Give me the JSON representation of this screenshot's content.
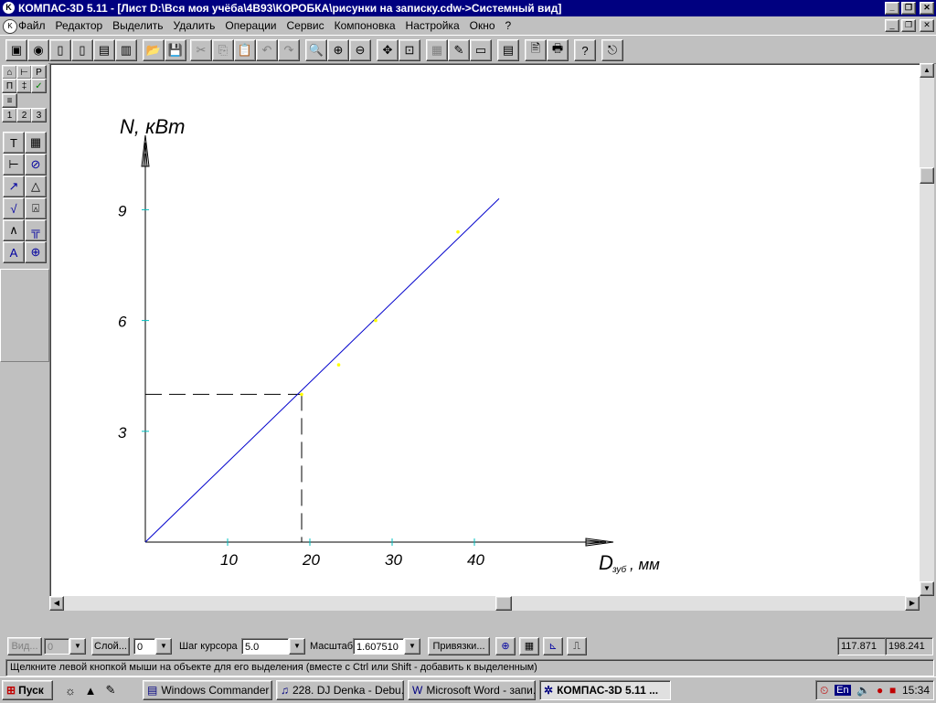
{
  "window": {
    "title": "КОМПАС-3D 5.11 - [Лист D:\\Вся моя учёба\\4В93\\КОРОБКА\\рисунки на записку.cdw->Системный вид]",
    "app_icon_glyph": "K",
    "minimize_glyph": "_",
    "maximize_glyph": "❐",
    "close_glyph": "✕"
  },
  "menu": {
    "items": [
      "Файл",
      "Редактор",
      "Выделить",
      "Удалить",
      "Операции",
      "Сервис",
      "Компоновка",
      "Настройка",
      "Окно",
      "?"
    ]
  },
  "toolbar": {
    "icons": [
      "save-all-icon",
      "preview-icon",
      "new-sheet-icon",
      "new-fragment-icon",
      "new-document-icon",
      "new-spec-icon",
      "open-icon",
      "save-icon",
      "cut-icon",
      "copy-icon",
      "paste-icon",
      "undo-icon",
      "redo-icon",
      "zoom-icon",
      "zoom-in-icon",
      "zoom-out-icon",
      "pan-icon",
      "zoom-fit-icon",
      "layers-icon",
      "properties-icon",
      "view-icon",
      "calculator-icon",
      "print-preview-icon",
      "print-icon",
      "help-icon",
      "exit-icon"
    ],
    "glyphs": [
      "▣",
      "◉",
      "▯",
      "▯",
      "▤",
      "▥",
      "📂",
      "💾",
      "✂",
      "⎘",
      "📋",
      "↶",
      "↷",
      "🔍",
      "⊕",
      "⊖",
      "✥",
      "⊡",
      "▦",
      "✎",
      "▭",
      "▤",
      "🖹",
      "🖶",
      "?",
      "⎋"
    ]
  },
  "left_panel": {
    "tabs": [
      "1",
      "2",
      "3"
    ],
    "top_glyphs": [
      "⌂",
      "⊢",
      "Р",
      "П",
      "‡",
      "✓",
      "≡"
    ],
    "tools": [
      "Т",
      "▦",
      "⊢",
      "⊘",
      "↗",
      "△",
      "√",
      "⍓",
      "∧",
      "╦",
      "A",
      "⊕"
    ]
  },
  "chart_data": {
    "type": "line",
    "ylabel": "N, кВт",
    "xlabel_main": "D",
    "xlabel_sub": "зуб",
    "xlabel_unit": ", мм",
    "x_ticks": [
      "10",
      "20",
      "30",
      "40"
    ],
    "y_ticks": [
      "9",
      "6",
      "3"
    ],
    "xlim": [
      0,
      55
    ],
    "ylim": [
      0,
      11
    ],
    "line": {
      "x": [
        0,
        43
      ],
      "y": [
        0,
        9.3
      ]
    },
    "points": [
      {
        "x": 23.5,
        "y": 4.8
      },
      {
        "x": 28,
        "y": 6
      },
      {
        "x": 38,
        "y": 8.4
      }
    ],
    "reference": {
      "x": 19,
      "y": 4
    },
    "line_color": "#0000cc",
    "tick_color": "#00c0c0",
    "point_color": "#ffff00"
  },
  "params": {
    "view_label": "Вид...",
    "view_value": "0",
    "layer_label": "Слой...",
    "layer_value": "0",
    "step_label": "Шаг курсора",
    "step_value": "5.0",
    "scale_label": "Масштаб",
    "scale_value": "1.607510",
    "snaps_label": "Привязки...",
    "coord_x": "117.871",
    "coord_y": "198.241"
  },
  "status_text": "Щелкните левой кнопкой мыши на объекте для его выделения (вместе с Ctrl или Shift - добавить к выделенным)",
  "taskbar": {
    "start_label": "Пуск",
    "quick_glyphs": [
      "☼",
      "▲",
      "✎"
    ],
    "tasks": [
      {
        "label": "Windows Commander ...",
        "glyph": "▤",
        "active": false
      },
      {
        "label": "228. DJ Denka - Debu...",
        "glyph": "♫",
        "active": false
      },
      {
        "label": "Microsoft Word - запи...",
        "glyph": "W",
        "active": false
      },
      {
        "label": "КОМПАС-3D 5.11 ...",
        "glyph": "✲",
        "active": true
      }
    ],
    "lang": "En",
    "time": "15:34"
  }
}
